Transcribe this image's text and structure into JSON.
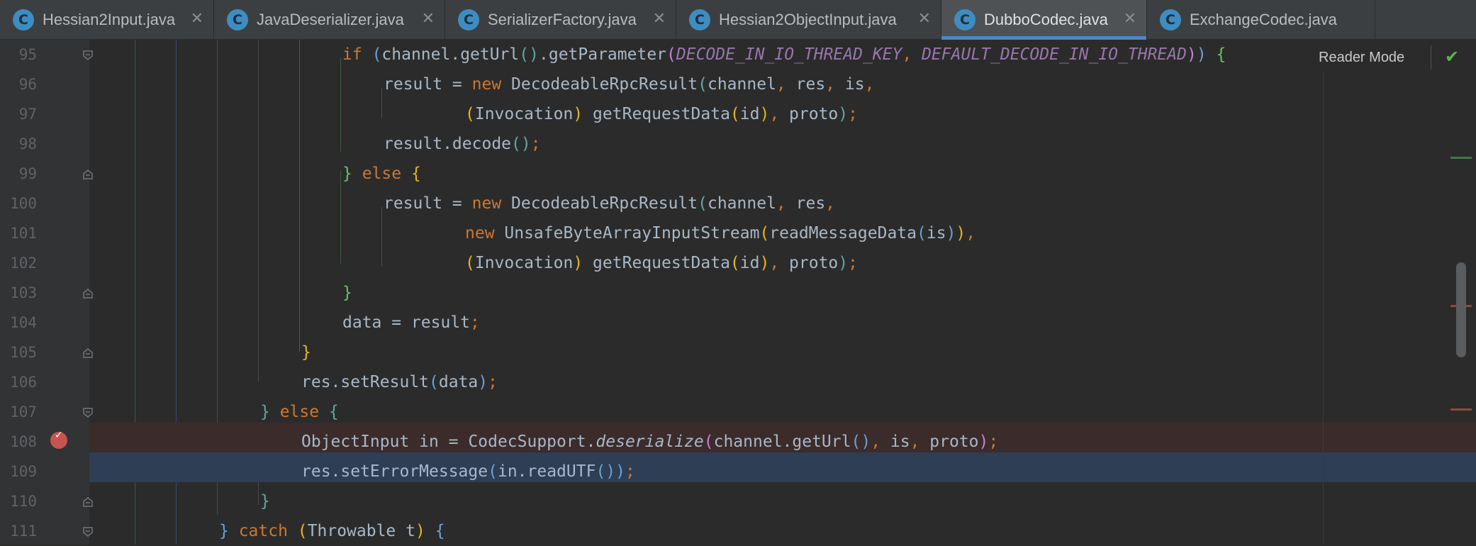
{
  "tabs": [
    {
      "icon_letter": "C",
      "title": "Hessian2Input.java",
      "active": false
    },
    {
      "icon_letter": "C",
      "title": "JavaDeserializer.java",
      "active": false
    },
    {
      "icon_letter": "C",
      "title": "SerializerFactory.java",
      "active": false
    },
    {
      "icon_letter": "C",
      "title": "Hessian2ObjectInput.java",
      "active": false
    },
    {
      "icon_letter": "C",
      "title": "DubboCodec.java",
      "active": true
    },
    {
      "icon_letter": "C",
      "title": "ExchangeCodec.java",
      "active": false
    }
  ],
  "tab_close_glyph": "✕",
  "reader_mode_label": "Reader Mode",
  "inspection_icon": "check-icon",
  "line_numbers": [
    "95",
    "96",
    "97",
    "98",
    "99",
    "100",
    "101",
    "102",
    "103",
    "104",
    "105",
    "106",
    "107",
    "108",
    "109",
    "110",
    "111"
  ],
  "code": {
    "l95": {
      "kw_if": "if",
      "open": "(",
      "t1": "channel.getUrl",
      "pp": "()",
      "t2": ".getParameter",
      "po": "(",
      "c1": "DECODE_IN_IO_THREAD_KEY",
      "comma": ", ",
      "c2": "DEFAULT_DECODE_IN_IO_THREAD",
      "pc": ")",
      "close": ")",
      "brace": " {"
    },
    "l96": {
      "t1": "result = ",
      "kw_new": "new",
      "t2": " DecodeableRpcResult",
      "po": "(",
      "t3": "channel",
      "c1": ", ",
      "t4": "res",
      "c2": ", ",
      "t5": "is",
      "c3": ","
    },
    "l97": {
      "po": "(",
      "t1": "Invocation",
      "pc": ")",
      "t2": " getRequestData",
      "po2": "(",
      "t3": "id",
      "pc2": ")",
      "c1": ", ",
      "t4": "proto",
      "pc3": ")",
      "semi": ";"
    },
    "l98": {
      "t1": "result.decode",
      "pp": "()",
      "semi": ";"
    },
    "l99": {
      "brace1": "} ",
      "kw_else": "else",
      "brace2": " {"
    },
    "l100": {
      "t1": "result = ",
      "kw_new": "new",
      "t2": " DecodeableRpcResult",
      "po": "(",
      "t3": "channel",
      "c1": ", ",
      "t4": "res",
      "c2": ","
    },
    "l101": {
      "kw_new": "new",
      "t1": " UnsafeByteArrayInputStream",
      "po": "(",
      "t2": "readMessageData",
      "po2": "(",
      "t3": "is",
      "pc2": ")",
      "pc": ")",
      "c1": ","
    },
    "l102": {
      "po": "(",
      "t1": "Invocation",
      "pc": ")",
      "t2": " getRequestData",
      "po2": "(",
      "t3": "id",
      "pc2": ")",
      "c1": ", ",
      "t4": "proto",
      "pc3": ")",
      "semi": ";"
    },
    "l103": {
      "brace": "}"
    },
    "l104": {
      "t1": "data = result",
      "semi": ";"
    },
    "l105": {
      "brace": "}"
    },
    "l106": {
      "t1": "res.setResult",
      "po": "(",
      "t2": "data",
      "pc": ")",
      "semi": ";"
    },
    "l107": {
      "brace1": "} ",
      "kw_else": "else",
      "brace2": " {"
    },
    "l108": {
      "t1": "ObjectInput in = CodecSupport.",
      "t2": "deserialize",
      "po": "(",
      "t3": "channel.getUrl",
      "pp": "()",
      "c1": ", ",
      "t4": "is",
      "c2": ", ",
      "t5": "proto",
      "pc": ")",
      "semi": ";"
    },
    "l109": {
      "t1": "res.setErrorMessage",
      "po": "(",
      "t2": "in.readUTF",
      "pp": "()",
      "pc": ")",
      "semi": ";"
    },
    "l110": {
      "brace": "}"
    },
    "l111": {
      "brace1": "} ",
      "kw_catch": "catch",
      "po": " (",
      "t1": "Throwable t",
      "pc": ")",
      "brace2": " {"
    }
  },
  "colors": {
    "background": "#2b2b2b",
    "gutter": "#313335",
    "keyword": "#cc7832",
    "text": "#a9b7c6",
    "constant": "#9876aa",
    "breakpoint": "#c75450",
    "breakpoint_line_bg": "#3b2b2b",
    "current_line_bg": "#2d3e55",
    "active_tab_underline": "#4a88c7"
  }
}
